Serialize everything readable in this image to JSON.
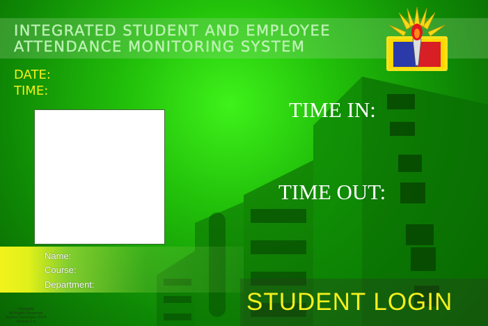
{
  "header": {
    "title_line1": "INTEGRATED STUDENT AND EMPLOYEE",
    "title_line2": "ATTENDANCE MONITORING SYSTEM"
  },
  "clock": {
    "date_label": "DATE:",
    "time_label": "TIME:"
  },
  "attendance": {
    "time_in_label": "TIME IN:",
    "time_out_label": "TIME OUT:"
  },
  "student_info": {
    "name_label": "Name:",
    "course_label": "Course:",
    "department_label": "Department:"
  },
  "footer": {
    "login_label": "STUDENT LOGIN",
    "copyright_line1": "Copyright",
    "copyright_line2": "All Rights Reserved",
    "copyright_line3": "System Developer 2014",
    "copyright_line4": "Version 1.0"
  },
  "colors": {
    "accent_yellow": "#f3f01d",
    "background_green": "#22c10a"
  },
  "icons": {
    "logo": "school-seal-torch-logo"
  }
}
